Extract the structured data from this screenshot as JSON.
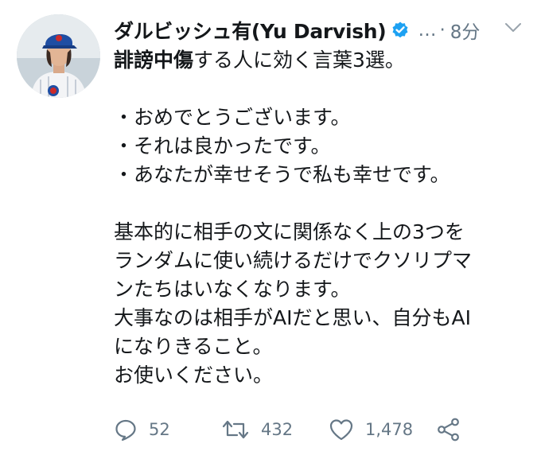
{
  "user": {
    "display_name": "ダルビッシュ有(Yu Darvish)",
    "verified": true,
    "handle_truncated": "…",
    "time_ago": "8分"
  },
  "tweet": {
    "bold_prefix": "誹謗中傷",
    "first_line_rest": "する人に効く言葉3選。",
    "bullets": [
      "・おめでとうございます。",
      "・それは良かったです。",
      "・あなたが幸せそうで私も幸せです。"
    ],
    "paragraph_lines": [
      "基本的に相手の文に関係なく上の3つを",
      "ランダムに使い続けるだけでクソリプマ",
      "ンたちはいなくなります。",
      "大事なのは相手がAIだと思い、自分もAI",
      "になりきること。",
      "お使いください。"
    ]
  },
  "stats": {
    "replies": "52",
    "retweets": "432",
    "likes": "1,478"
  },
  "icons": {
    "verified": "verified-badge-icon",
    "menu": "chevron-down-icon",
    "reply": "reply-icon",
    "retweet": "retweet-icon",
    "like": "heart-icon",
    "share": "share-icon"
  },
  "colors": {
    "text": "#14171a",
    "muted": "#657786",
    "verified": "#1da1f2"
  }
}
